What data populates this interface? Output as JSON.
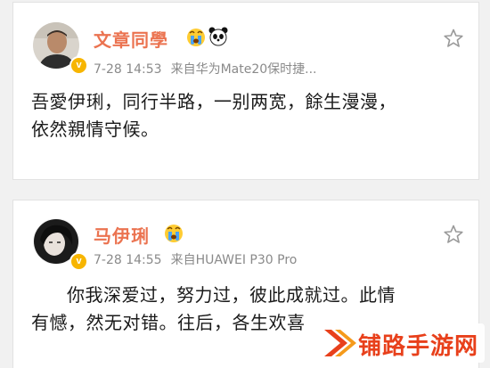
{
  "posts": [
    {
      "username": "文章同學",
      "emojis": [
        "crying-face-emoji",
        "panda-emoji"
      ],
      "verified": true,
      "time": "7-28 14:53",
      "source": "来自华为Mate20保时捷...",
      "content_lines": [
        "吾愛伊琍，同行半路，一别两宽，餘生漫漫，",
        "依然親情守候。"
      ]
    },
    {
      "username": "马伊琍",
      "emojis": [
        "crying-face-emoji"
      ],
      "verified": true,
      "time": "7-28 14:55",
      "source": "来自HUAWEI P30 Pro",
      "content_lines": [
        "你我深爱过，努力过，彼此成就过。此情",
        "有憾，然无对错。往后，各生欢喜"
      ]
    }
  ],
  "watermark": {
    "text": "铺路手游网"
  },
  "colors": {
    "username": "#eb7350",
    "meta": "#8a8a8a",
    "verified_badge": "#f7b500",
    "watermark": "#e8401b",
    "background": "#f1f1f1"
  }
}
